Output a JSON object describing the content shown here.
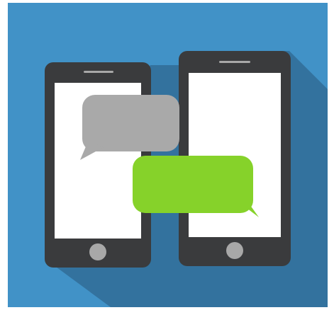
{
  "illustration": {
    "subject": "two-phones-messaging-icon",
    "colors": {
      "background": "#4192c7",
      "shadow": "#326f99",
      "phone_body": "#3a3b3d",
      "screen": "#ffffff",
      "home_button": "#a8a8a8",
      "speaker": "#a8a8a8",
      "bubble_gray": "#a9a9a9",
      "bubble_green": "#86d22a"
    },
    "icons": [
      "left-phone-icon",
      "right-phone-icon",
      "gray-chat-bubble-icon",
      "green-chat-bubble-icon"
    ]
  }
}
